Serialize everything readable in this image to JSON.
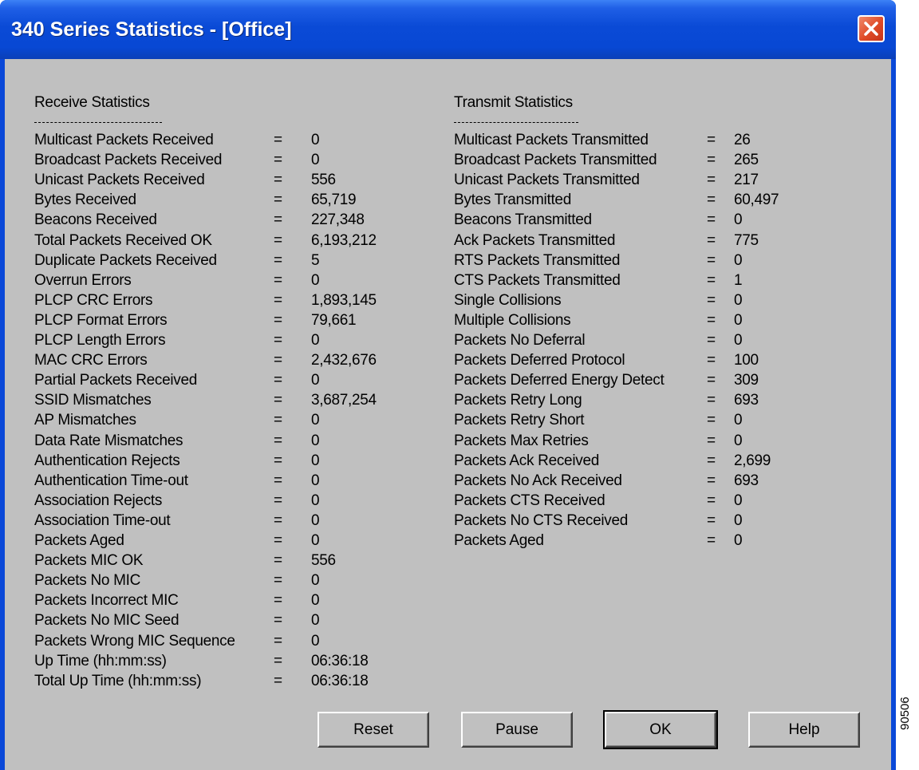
{
  "window": {
    "title": "340 Series Statistics - [Office]"
  },
  "receive": {
    "title": "Receive Statistics",
    "rows": [
      {
        "label": "Multicast Packets Received",
        "eq": "=",
        "value": "0"
      },
      {
        "label": "Broadcast Packets Received",
        "eq": "=",
        "value": "0"
      },
      {
        "label": "Unicast Packets Received",
        "eq": "=",
        "value": "556"
      },
      {
        "label": "Bytes Received",
        "eq": "=",
        "value": "65,719"
      },
      {
        "label": "Beacons Received",
        "eq": "=",
        "value": "227,348"
      },
      {
        "label": "Total Packets Received OK",
        "eq": "=",
        "value": "6,193,212"
      },
      {
        "label": "Duplicate Packets Received",
        "eq": "=",
        "value": "5"
      },
      {
        "label": "Overrun Errors",
        "eq": "=",
        "value": "0"
      },
      {
        "label": "PLCP CRC Errors",
        "eq": "=",
        "value": "1,893,145"
      },
      {
        "label": "PLCP Format Errors",
        "eq": "=",
        "value": "79,661"
      },
      {
        "label": "PLCP Length Errors",
        "eq": "=",
        "value": "0"
      },
      {
        "label": "MAC CRC Errors",
        "eq": "=",
        "value": "2,432,676"
      },
      {
        "label": "Partial Packets Received",
        "eq": "=",
        "value": "0"
      },
      {
        "label": "SSID Mismatches",
        "eq": "=",
        "value": "3,687,254"
      },
      {
        "label": "AP Mismatches",
        "eq": "=",
        "value": "0"
      },
      {
        "label": "Data Rate Mismatches",
        "eq": "=",
        "value": "0"
      },
      {
        "label": "Authentication Rejects",
        "eq": "=",
        "value": "0"
      },
      {
        "label": "Authentication Time-out",
        "eq": "=",
        "value": "0"
      },
      {
        "label": "Association Rejects",
        "eq": "=",
        "value": "0"
      },
      {
        "label": "Association Time-out",
        "eq": "=",
        "value": "0"
      },
      {
        "label": "Packets Aged",
        "eq": "=",
        "value": "0"
      },
      {
        "label": "Packets MIC OK",
        "eq": "=",
        "value": "556"
      },
      {
        "label": "Packets No MIC",
        "eq": "=",
        "value": "0"
      },
      {
        "label": "Packets Incorrect MIC",
        "eq": "=",
        "value": "0"
      },
      {
        "label": "Packets No MIC Seed",
        "eq": "=",
        "value": "0"
      },
      {
        "label": "Packets Wrong MIC Sequence",
        "eq": "=",
        "value": "0"
      },
      {
        "label": "Up Time (hh:mm:ss)",
        "eq": "=",
        "value": "06:36:18"
      },
      {
        "label": "Total Up Time (hh:mm:ss)",
        "eq": "=",
        "value": "06:36:18"
      }
    ]
  },
  "transmit": {
    "title": "Transmit Statistics",
    "rows": [
      {
        "label": "Multicast Packets Transmitted",
        "eq": "=",
        "value": "26"
      },
      {
        "label": "Broadcast Packets Transmitted",
        "eq": "=",
        "value": "265"
      },
      {
        "label": "Unicast Packets Transmitted",
        "eq": "=",
        "value": "217"
      },
      {
        "label": "Bytes Transmitted",
        "eq": "=",
        "value": "60,497"
      },
      {
        "label": "Beacons Transmitted",
        "eq": "=",
        "value": "0"
      },
      {
        "label": "Ack Packets Transmitted",
        "eq": "=",
        "value": "775"
      },
      {
        "label": "RTS Packets Transmitted",
        "eq": "=",
        "value": "0"
      },
      {
        "label": "CTS Packets Transmitted",
        "eq": "=",
        "value": "1"
      },
      {
        "label": "Single Collisions",
        "eq": "=",
        "value": "0"
      },
      {
        "label": "Multiple Collisions",
        "eq": "=",
        "value": "0"
      },
      {
        "label": "Packets No Deferral",
        "eq": "=",
        "value": "0"
      },
      {
        "label": "Packets Deferred Protocol",
        "eq": "=",
        "value": "100"
      },
      {
        "label": "Packets Deferred Energy Detect",
        "eq": "=",
        "value": "309"
      },
      {
        "label": "Packets Retry Long",
        "eq": "=",
        "value": "693"
      },
      {
        "label": "Packets Retry Short",
        "eq": "=",
        "value": "0"
      },
      {
        "label": "Packets Max Retries",
        "eq": "=",
        "value": "0"
      },
      {
        "label": "Packets Ack Received",
        "eq": "=",
        "value": "2,699"
      },
      {
        "label": "Packets No Ack Received",
        "eq": "=",
        "value": "693"
      },
      {
        "label": "Packets CTS Received",
        "eq": "=",
        "value": "0"
      },
      {
        "label": "Packets No CTS Received",
        "eq": "=",
        "value": "0"
      },
      {
        "label": "Packets Aged",
        "eq": "=",
        "value": "0"
      }
    ]
  },
  "buttons": {
    "reset": "Reset",
    "pause": "Pause",
    "ok": "OK",
    "help": "Help"
  },
  "figure_number": "90506",
  "icons": {
    "close": "close-icon"
  },
  "colors": {
    "titlebar": "#0a4ad6",
    "client": "#c0c0c0",
    "close": "#df4a26"
  }
}
